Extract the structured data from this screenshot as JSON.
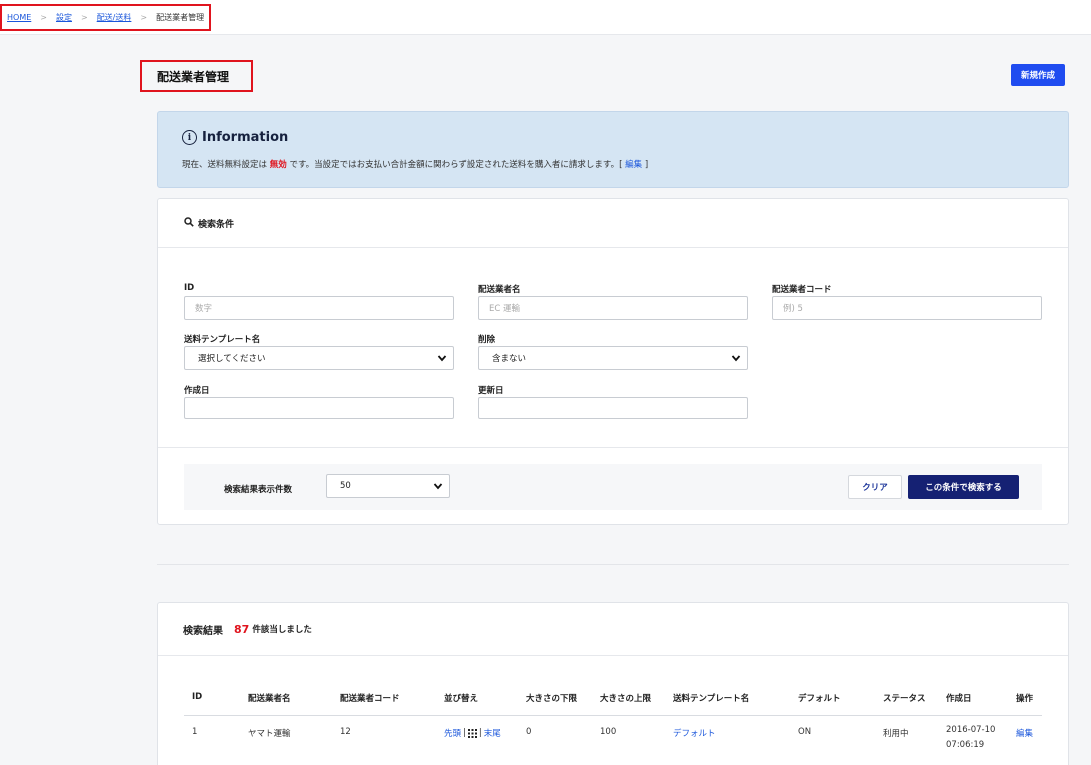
{
  "breadcrumb": {
    "items": [
      "HOME",
      "設定",
      "配送/送料"
    ],
    "separator": ">",
    "current": "配送業者管理"
  },
  "page": {
    "title": "配送業者管理",
    "new_button": "新規作成"
  },
  "info": {
    "title": "Information",
    "text_before": "現在、送料無料設定は",
    "status": "無効",
    "text_after": "です。当設定ではお支払い合計金額に関わらず設定された送料を購入者に請求します。[",
    "edit_link": "編集",
    "text_end": "]"
  },
  "search": {
    "header": "検索条件",
    "id_label": "ID",
    "id_placeholder": "数字",
    "name_label": "配送業者名",
    "name_placeholder": "EC 運輸",
    "code_label": "配送業者コード",
    "code_placeholder": "例) 5",
    "template_label": "送料テンプレート名",
    "template_value": "選択してください",
    "deleted_label": "削除",
    "deleted_value": "含まない",
    "created_label": "作成日",
    "created_value": "",
    "updated_label": "更新日",
    "updated_value": "",
    "per_page_label": "検索結果表示件数",
    "per_page_value": "50",
    "clear_button": "クリア",
    "search_button": "この条件で検索する"
  },
  "results": {
    "label": "検索結果",
    "count": "87",
    "suffix": "件該当しました",
    "columns": [
      "ID",
      "配送業者名",
      "配送業者コード",
      "並び替え",
      "大きさの下限",
      "大きさの上限",
      "送料テンプレート名",
      "デフォルト",
      "ステータス",
      "作成日",
      "操作"
    ],
    "rows": [
      {
        "id": "1",
        "name": "ヤマト運輸",
        "code": "12",
        "sort_first": "先頭",
        "sort_sep1": "|",
        "sort_sep2": "|",
        "sort_last": "末尾",
        "size_min": "0",
        "size_max": "100",
        "template": "デフォルト",
        "default": "ON",
        "status": "利用中",
        "created_date": "2016-07-10",
        "created_time": "07:06:19",
        "action": "編集"
      }
    ]
  },
  "colors": {
    "accent_red": "#e0141e",
    "primary_blue": "#1f4cf0",
    "navy": "#152173",
    "link": "#1a56db",
    "info_bg": "#d5e5f3"
  }
}
